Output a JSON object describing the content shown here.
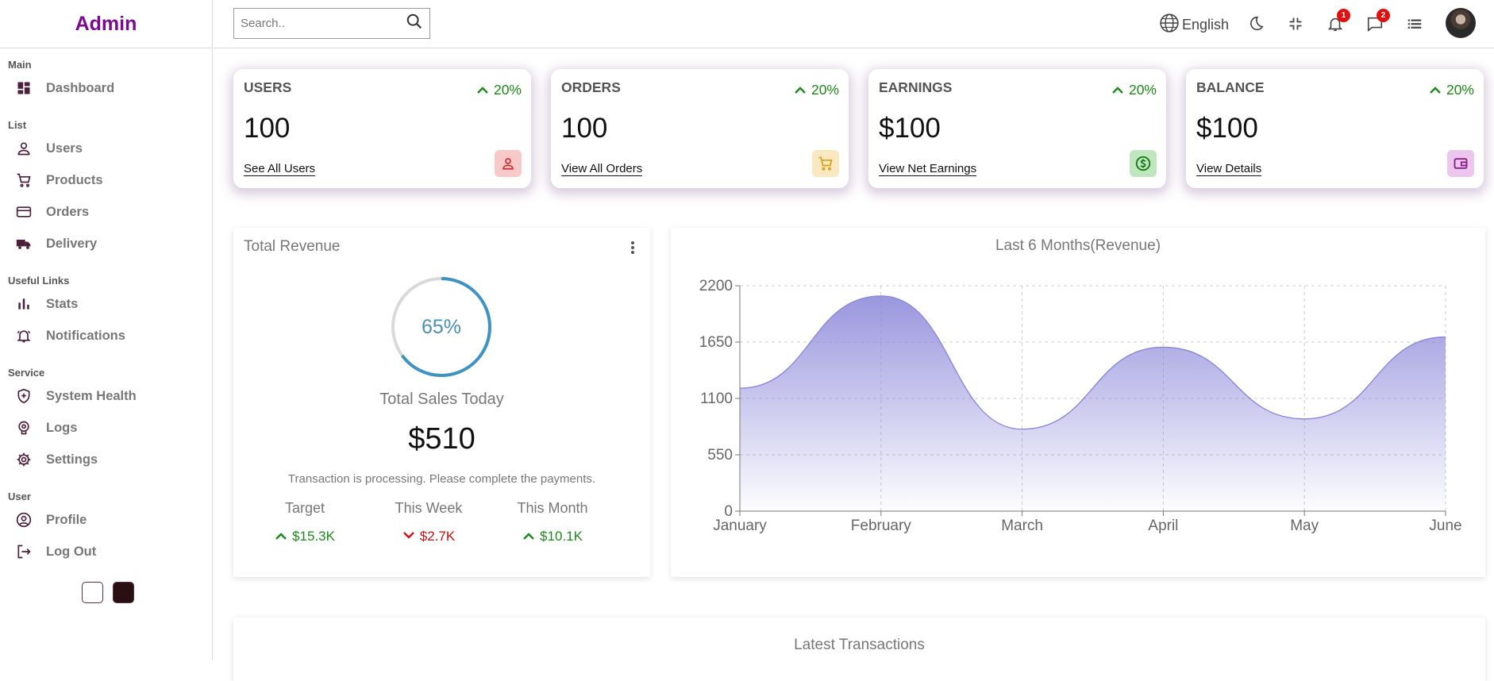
{
  "sidebar": {
    "logo": "Admin",
    "sections": [
      {
        "title": "Main",
        "items": [
          {
            "label": "Dashboard",
            "icon": "dashboard-icon"
          }
        ]
      },
      {
        "title": "List",
        "items": [
          {
            "label": "Users",
            "icon": "user-icon"
          },
          {
            "label": "Products",
            "icon": "cart-icon"
          },
          {
            "label": "Orders",
            "icon": "credit-card-icon"
          },
          {
            "label": "Delivery",
            "icon": "truck-icon"
          }
        ]
      },
      {
        "title": "Useful Links",
        "items": [
          {
            "label": "Stats",
            "icon": "bar-chart-icon"
          },
          {
            "label": "Notifications",
            "icon": "bell-icon"
          }
        ]
      },
      {
        "title": "Service",
        "items": [
          {
            "label": "System Health",
            "icon": "shield-icon"
          },
          {
            "label": "Logs",
            "icon": "brain-icon"
          },
          {
            "label": "Settings",
            "icon": "gear-icon"
          }
        ]
      },
      {
        "title": "User",
        "items": [
          {
            "label": "Profile",
            "icon": "account-circle-icon"
          },
          {
            "label": "Log Out",
            "icon": "logout-icon"
          }
        ]
      }
    ],
    "theme_swatches": [
      "#ffffff",
      "#2a0f12"
    ]
  },
  "topbar": {
    "search_placeholder": "Search..",
    "language": "English",
    "notifications_count": "1",
    "messages_count": "2"
  },
  "widgets": [
    {
      "title": "USERS",
      "percent": "20%",
      "value": "100",
      "link": "See All Users",
      "icon": "person-icon",
      "icon_color": "#d32f2f",
      "icon_bg": "#f8c9c9"
    },
    {
      "title": "ORDERS",
      "percent": "20%",
      "value": "100",
      "link": "View All Orders",
      "icon": "shopping-cart-icon",
      "icon_color": "#d4a017",
      "icon_bg": "#f9e8c0"
    },
    {
      "title": "EARNINGS",
      "percent": "20%",
      "value": "$100",
      "link": "View Net Earnings",
      "icon": "dollar-icon",
      "icon_color": "#137a13",
      "icon_bg": "#bfe6bf"
    },
    {
      "title": "BALANCE",
      "percent": "20%",
      "value": "$100",
      "link": "View Details",
      "icon": "wallet-icon",
      "icon_color": "#8a1f8a",
      "icon_bg": "#ecc6ec"
    }
  ],
  "revenue": {
    "title": "Total Revenue",
    "progress_percent": 65,
    "progress_label": "65%",
    "sales_label": "Total Sales Today",
    "sales_value": "$510",
    "note": "Transaction is processing. Please complete the payments.",
    "stats": [
      {
        "label": "Target",
        "value": "$15.3K",
        "trend": "up"
      },
      {
        "label": "This Week",
        "value": "$2.7K",
        "trend": "down"
      },
      {
        "label": "This Month",
        "value": "$10.1K",
        "trend": "up"
      }
    ]
  },
  "chart_data": {
    "type": "area",
    "title": "Last 6 Months(Revenue)",
    "categories": [
      "January",
      "February",
      "March",
      "April",
      "May",
      "June"
    ],
    "series": [
      {
        "values": [
          1200,
          2100,
          800,
          1600,
          900,
          1700
        ]
      }
    ],
    "yticks": [
      0,
      550,
      1100,
      1650,
      2200
    ],
    "ylim": [
      0,
      2200
    ],
    "grid": true,
    "color": "#8884d8"
  },
  "latest": {
    "title": "Latest Transactions"
  }
}
